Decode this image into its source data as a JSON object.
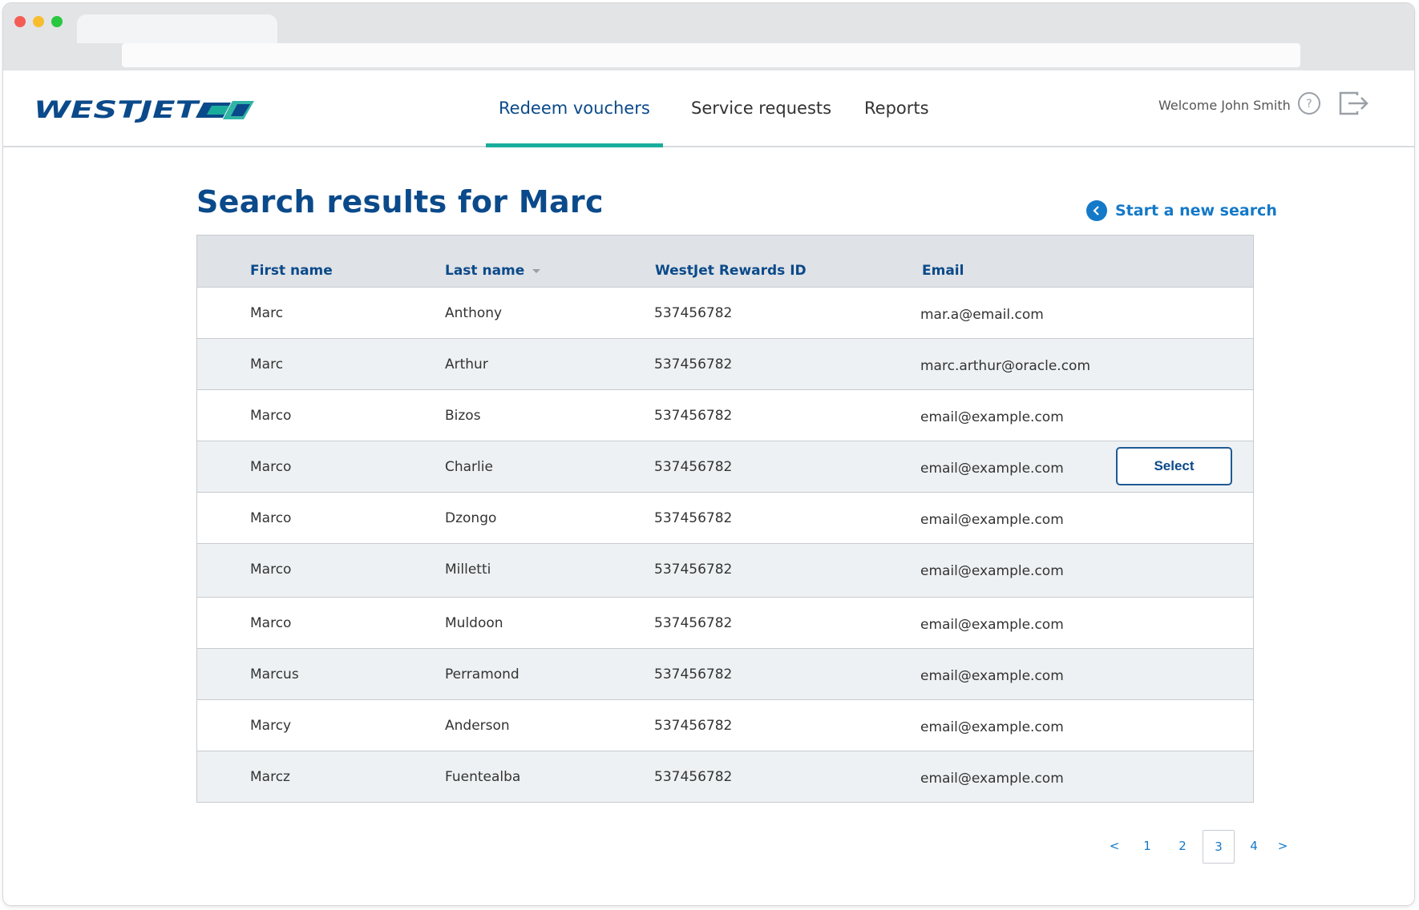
{
  "nav": {
    "brand": "WESTJET",
    "items": [
      {
        "label": "Redeem vouchers",
        "active": true
      },
      {
        "label": "Service requests",
        "active": false
      },
      {
        "label": "Reports",
        "active": false
      }
    ],
    "welcome": "Welcome John Smith",
    "help_icon": "question-circle-icon",
    "logout_icon": "logout-icon"
  },
  "page": {
    "title": "Search results for Marc",
    "new_search_label": "Start a new search"
  },
  "table": {
    "headers": [
      "First name",
      "Last name",
      "WestJet  Rewards ID",
      "Email"
    ],
    "sorted_column": "Last name",
    "rows": [
      {
        "first": "Marc",
        "last": "Anthony",
        "id": "537456782",
        "email": "mar.a@email.com"
      },
      {
        "first": "Marc",
        "last": "Arthur",
        "id": "537456782",
        "email": "marc.arthur@oracle.com"
      },
      {
        "first": "Marco",
        "last": "Bizos",
        "id": "537456782",
        "email": "email@example.com"
      },
      {
        "first": "Marco",
        "last": "Charlie",
        "id": "537456782",
        "email": "email@example.com"
      },
      {
        "first": "Marco",
        "last": "Dzongo",
        "id": "537456782",
        "email": "email@example.com"
      },
      {
        "first": "Marco",
        "last": "Milletti",
        "id": "537456782",
        "email": "email@example.com"
      },
      {
        "first": "Marco",
        "last": "Muldoon",
        "id": "537456782",
        "email": "email@example.com"
      },
      {
        "first": "Marcus",
        "last": "Perramond",
        "id": "537456782",
        "email": "email@example.com"
      },
      {
        "first": "Marcy",
        "last": "Anderson",
        "id": "537456782",
        "email": "email@example.com"
      },
      {
        "first": "Marcz",
        "last": "Fuentealba",
        "id": "537456782",
        "email": "email@example.com"
      }
    ],
    "select_label": "Select",
    "select_row": 3
  },
  "pagination": {
    "prev": "<",
    "pages": [
      "1",
      "2",
      "3",
      "4"
    ],
    "current": "3",
    "next": ">"
  },
  "colors": {
    "brand_blue": "#0b4a8a",
    "accent_teal": "#1bad9c",
    "link_blue": "#1479c8"
  }
}
